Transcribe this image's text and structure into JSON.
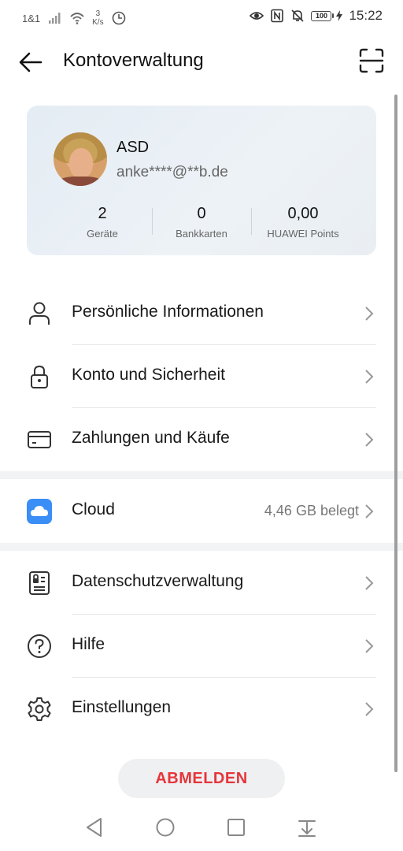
{
  "status_bar": {
    "carrier": "1&1",
    "speed_value": "3",
    "speed_unit": "K/s",
    "battery": "100",
    "time": "15:22"
  },
  "header": {
    "title": "Kontoverwaltung"
  },
  "profile": {
    "name": "ASD",
    "email": "anke****@**b.de",
    "stats": [
      {
        "value": "2",
        "label": "Geräte"
      },
      {
        "value": "0",
        "label": "Bankkarten"
      },
      {
        "value": "0,00",
        "label": "HUAWEI Points"
      }
    ]
  },
  "menu": {
    "items": [
      {
        "label": "Persönliche Informationen",
        "icon": "person-icon"
      },
      {
        "label": "Konto und Sicherheit",
        "icon": "lock-icon"
      },
      {
        "label": "Zahlungen und Käufe",
        "icon": "card-icon"
      },
      {
        "label": "Cloud",
        "value": "4,46 GB belegt",
        "icon": "cloud-icon"
      },
      {
        "label": "Datenschutzverwaltung",
        "icon": "privacy-icon"
      },
      {
        "label": "Hilfe",
        "icon": "help-icon"
      },
      {
        "label": "Einstellungen",
        "icon": "gear-icon"
      }
    ]
  },
  "logout_label": "ABMELDEN",
  "colors": {
    "accent_red": "#e6353a",
    "cloud_blue": "#3a8ef6",
    "card_bg": "#e7edf3"
  }
}
